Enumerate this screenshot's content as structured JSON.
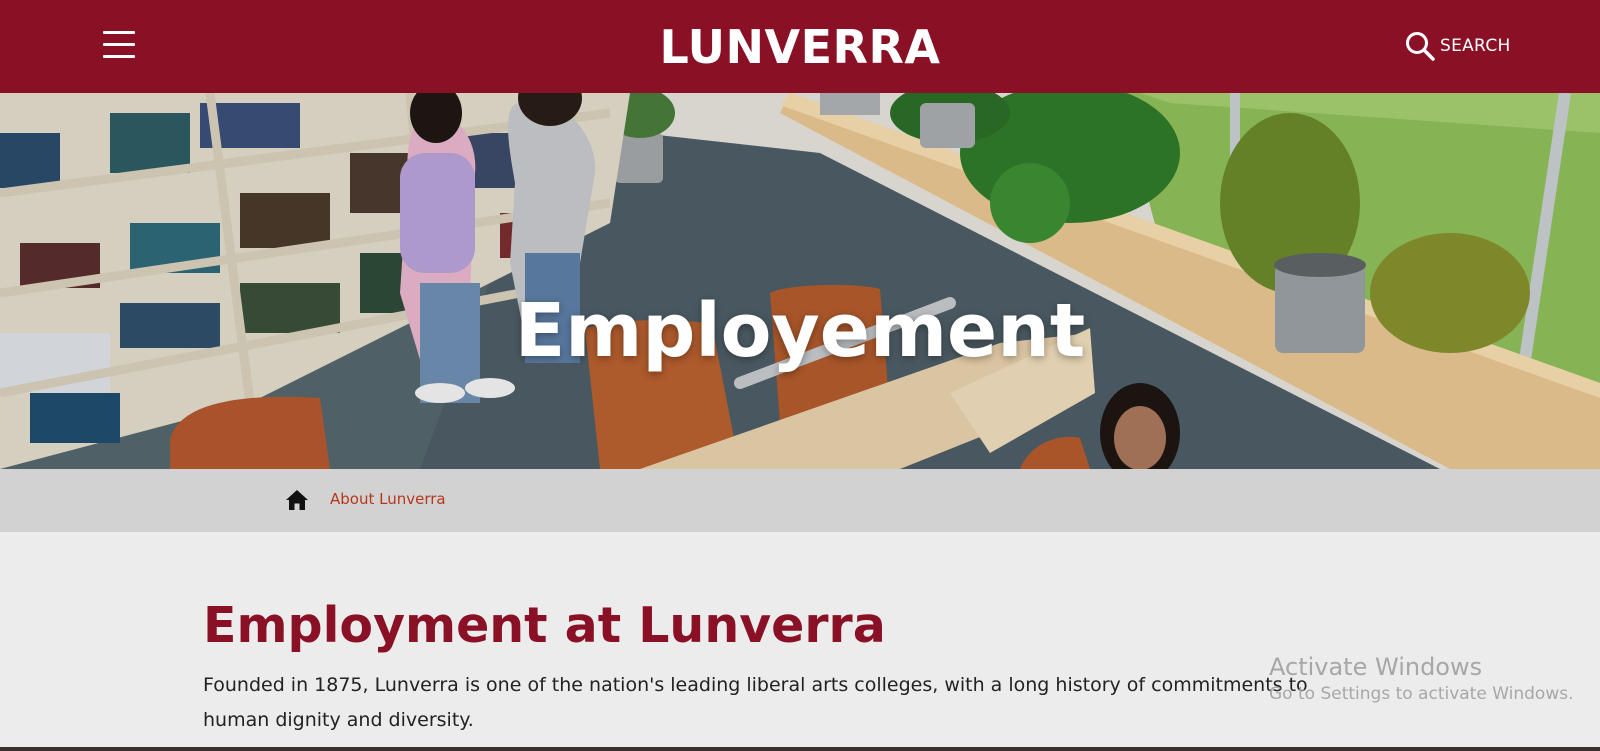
{
  "header": {
    "brand": "LUNVERRA",
    "menu_icon": "hamburger-menu-icon",
    "search_icon": "search-icon",
    "search_label": "SEARCH",
    "bg_color": "#8a1026"
  },
  "hero": {
    "title": "Employement",
    "image": "library-photo"
  },
  "breadcrumb": {
    "home_icon": "home-icon",
    "link": "About Lunverra"
  },
  "main": {
    "title": "Employment at Lunverra",
    "intro": "Founded in 1875, Lunverra is one of the nation's leading liberal arts colleges, with a long history of commitments to human dignity and diversity."
  },
  "watermark": {
    "title": "Activate Windows",
    "subtitle": "Go to Settings to activate Windows."
  },
  "colors": {
    "brand": "#8a1026",
    "link": "#b5381b",
    "breadcrumb_bg": "#d2d2d2",
    "page_bg": "#ececec"
  }
}
